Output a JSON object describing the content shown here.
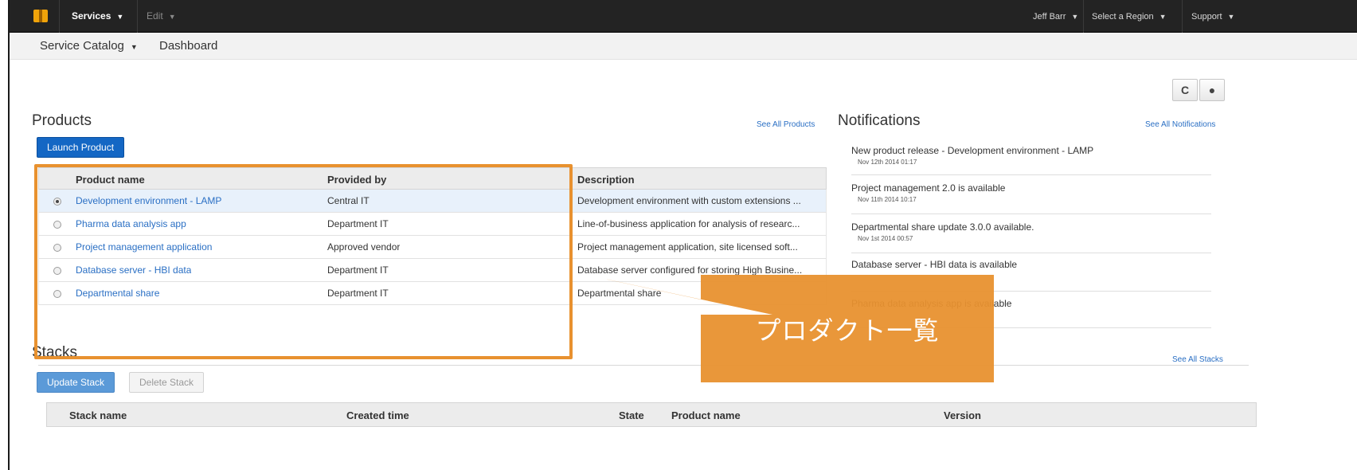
{
  "topnav": {
    "services": "Services",
    "edit": "Edit",
    "user": "Jeff Barr",
    "region": "Select a Region",
    "support": "Support"
  },
  "subnav": {
    "service_catalog": "Service Catalog",
    "dashboard": "Dashboard"
  },
  "toolbar": {
    "refresh_icon": "refresh-icon",
    "help_icon": "help-icon"
  },
  "products": {
    "title": "Products",
    "see_all": "See All Products",
    "launch_button": "Launch Product",
    "columns": [
      "Product name",
      "Provided by",
      "Description"
    ],
    "rows": [
      {
        "name": "Development environment - LAMP",
        "provider": "Central IT",
        "description": "Development environment with custom extensions ...",
        "selected": true
      },
      {
        "name": "Pharma data analysis app",
        "provider": "Department IT",
        "description": "Line-of-business application for analysis of researc...",
        "selected": false
      },
      {
        "name": "Project management application",
        "provider": "Approved vendor",
        "description": "Project management application, site licensed soft...",
        "selected": false
      },
      {
        "name": "Database server - HBI data",
        "provider": "Department IT",
        "description": "Database server configured for storing High Busine...",
        "selected": false
      },
      {
        "name": "Departmental share",
        "provider": "Department IT",
        "description": "Departmental share",
        "selected": false
      }
    ]
  },
  "notifications": {
    "title": "Notifications",
    "see_all": "See All Notifications",
    "items": [
      {
        "message": "New product release - Development environment - LAMP",
        "timestamp": "Nov 12th 2014 01:17"
      },
      {
        "message": "Project management 2.0 is available",
        "timestamp": "Nov 11th 2014 10:17"
      },
      {
        "message": "Departmental share update 3.0.0 available.",
        "timestamp": "Nov 1st 2014 00:57"
      },
      {
        "message": "Database server - HBI data is available",
        "timestamp": ""
      },
      {
        "message": "Pharma data analysis app is available",
        "timestamp": ""
      }
    ]
  },
  "stacks": {
    "title": "Stacks",
    "see_all": "See All Stacks",
    "update_button": "Update Stack",
    "delete_button": "Delete Stack",
    "columns": [
      "Stack name",
      "Created time",
      "State",
      "Product name",
      "Version"
    ]
  },
  "annotation": {
    "label": "プロダクト一覧",
    "color": "#e8912f"
  }
}
